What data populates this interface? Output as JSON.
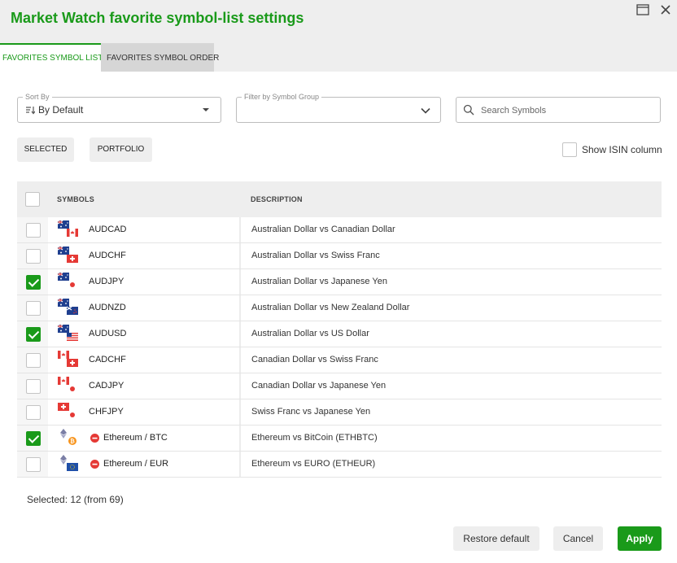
{
  "dialog": {
    "title": "Market Watch favorite symbol-list settings"
  },
  "window_icons": [
    "restore-window-icon",
    "close-icon"
  ],
  "tabs": [
    {
      "label": "FAVORITES SYMBOL LIST",
      "active": true
    },
    {
      "label": "FAVORITES SYMBOL ORDER",
      "active": false
    }
  ],
  "sort": {
    "legend": "Sort By",
    "value": "By Default"
  },
  "filter": {
    "legend": "Filter by Symbol Group",
    "value": ""
  },
  "search": {
    "placeholder": "Search Symbols",
    "value": ""
  },
  "pills": {
    "selected": "SELECTED",
    "portfolio": "PORTFOLIO"
  },
  "isin": {
    "label": "Show ISIN column",
    "checked": false
  },
  "table": {
    "headers": {
      "symbols": "SYMBOLS",
      "description": "DESCRIPTION"
    },
    "rows": [
      {
        "symbol": "AUDCAD",
        "description": "Australian Dollar vs Canadian Dollar",
        "checked": false,
        "flags": [
          "au",
          "ca"
        ],
        "stop": false
      },
      {
        "symbol": "AUDCHF",
        "description": "Australian Dollar vs Swiss Franc",
        "checked": false,
        "flags": [
          "au",
          "ch"
        ],
        "stop": false
      },
      {
        "symbol": "AUDJPY",
        "description": "Australian Dollar vs Japanese Yen",
        "checked": true,
        "flags": [
          "au",
          "jp"
        ],
        "stop": false
      },
      {
        "symbol": "AUDNZD",
        "description": "Australian Dollar vs New Zealand Dollar",
        "checked": false,
        "flags": [
          "au",
          "nz"
        ],
        "stop": false
      },
      {
        "symbol": "AUDUSD",
        "description": "Australian Dollar vs US Dollar",
        "checked": true,
        "flags": [
          "au",
          "us"
        ],
        "stop": false
      },
      {
        "symbol": "CADCHF",
        "description": "Canadian Dollar vs Swiss Franc",
        "checked": false,
        "flags": [
          "ca",
          "ch"
        ],
        "stop": false
      },
      {
        "symbol": "CADJPY",
        "description": "Canadian Dollar vs Japanese Yen",
        "checked": false,
        "flags": [
          "ca",
          "jp"
        ],
        "stop": false
      },
      {
        "symbol": "CHFJPY",
        "description": "Swiss Franc vs Japanese Yen",
        "checked": false,
        "flags": [
          "ch",
          "jp"
        ],
        "stop": false
      },
      {
        "symbol": "Ethereum / BTC",
        "description": "Ethereum vs BitCoin (ETHBTC)",
        "checked": true,
        "flags": [
          "eth",
          "btc"
        ],
        "stop": true
      },
      {
        "symbol": "Ethereum / EUR",
        "description": "Ethereum vs EURO (ETHEUR)",
        "checked": false,
        "flags": [
          "eth",
          "eu"
        ],
        "stop": true
      }
    ]
  },
  "footer": {
    "selected_text": "Selected: 12 (from 69)",
    "restore_label": "Restore default",
    "cancel_label": "Cancel",
    "apply_label": "Apply"
  },
  "colors": {
    "accent": "#1a9a1a",
    "header_bg": "#eeeeee",
    "stop": "#e53935"
  }
}
